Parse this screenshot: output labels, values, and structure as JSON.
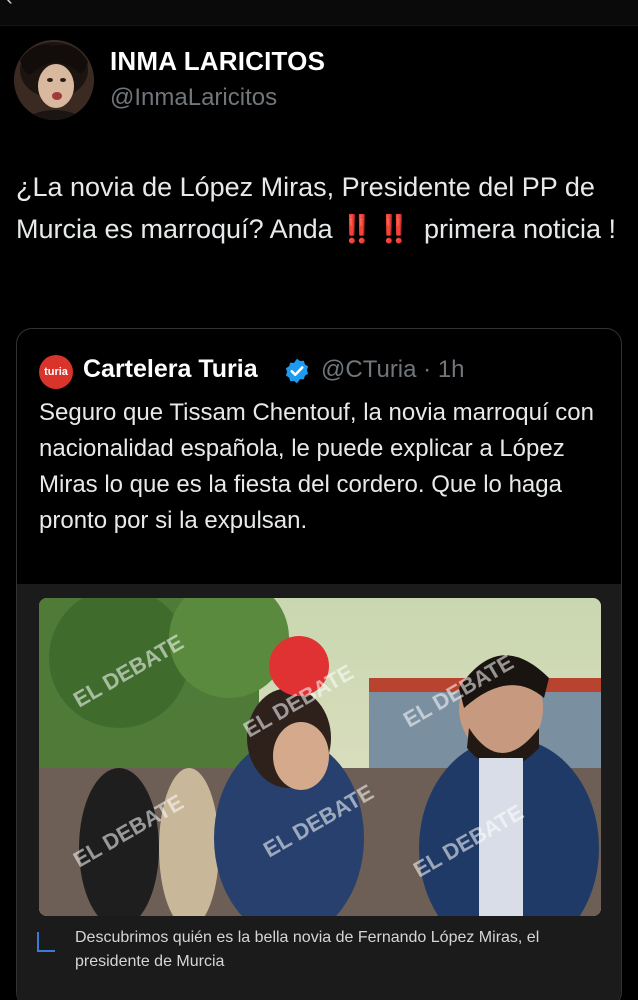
{
  "post": {
    "author_name": "INMA LARICITOS",
    "author_handle": "@InmaLaricitos",
    "text_part1": "¿La novia de López Miras, Presidente del PP de Murcia es marroquí? Anda",
    "emoji": "‼️ ‼️",
    "text_part2": " primera noticia !"
  },
  "quote": {
    "logo_text": "turia",
    "name": "Cartelera Turia",
    "handle_time": "@CTuria · 1h",
    "text": "Seguro que Tissam Chentouf, la novia marroquí con nacionalidad española, le puede explicar a López Miras lo que es la fiesta del cordero. Que lo haga pronto por si la expulsan.",
    "image_watermark": "EL DEBATE",
    "caption": "Descubrimos quién es la bella novia de Fernando López Miras, el presidente de Murcia"
  },
  "icons": {
    "verified": "verified-badge-icon",
    "caption": "link-corner-icon",
    "back": "back-arrow-icon"
  },
  "colors": {
    "background": "#000000",
    "accent_blue": "#1d9bf0",
    "brand_red": "#d9342b",
    "muted": "#71767b"
  }
}
